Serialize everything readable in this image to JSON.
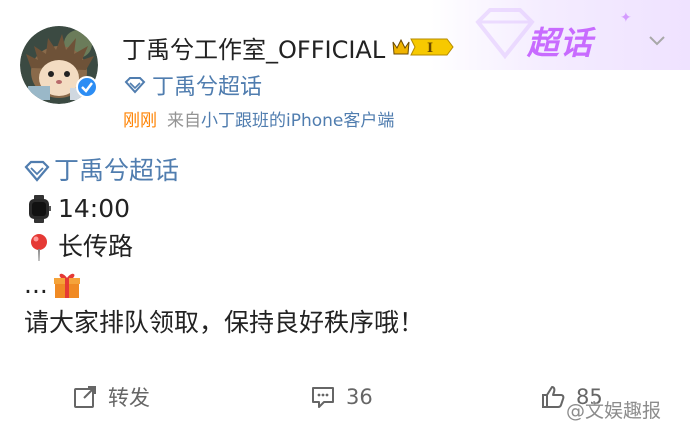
{
  "header": {
    "username": "丁禹兮工作室_OFFICIAL",
    "level_badge": "I",
    "supertopic_link": "丁禹兮超话",
    "timestamp": "刚刚",
    "source_prefix": "来自",
    "source_device": "小丁跟班的iPhone客户端",
    "corner_label": "超话"
  },
  "post": {
    "topic": "丁禹兮超话",
    "time_line": "14:00",
    "place_line": "长传路",
    "gift_prefix": "...",
    "message": "请大家排队领取，保持良好秩序哦！"
  },
  "actions": {
    "repost_label": "转发",
    "comment_count": "36",
    "like_count": "85"
  },
  "watermark": {
    "text": "@文娱趣报"
  },
  "colors": {
    "link": "#507daf",
    "timestamp": "#ff8200",
    "muted": "#939393",
    "supertopic_purple": "#c86bff"
  },
  "icons": {
    "topic": "diamond-icon",
    "time": "watch-emoji",
    "place": "pin-emoji",
    "gift": "gift-emoji",
    "repost": "share-icon",
    "comment": "comment-icon",
    "like": "thumbs-up-icon",
    "verified": "verified-badge-icon",
    "menu": "chevron-down-icon"
  }
}
